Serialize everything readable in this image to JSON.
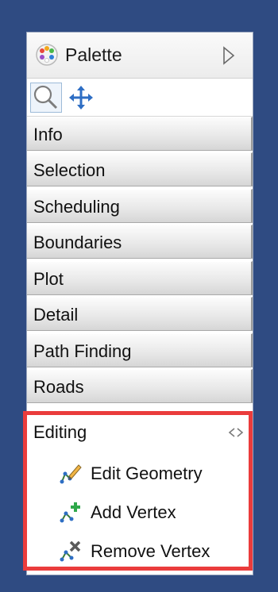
{
  "palette": {
    "title": "Palette",
    "icon": "palette-icon",
    "expand_icon": "triangle-right-icon"
  },
  "toolbar": {
    "tools": [
      {
        "icon": "magnifier-icon",
        "selected": true
      },
      {
        "icon": "move-arrows-icon",
        "selected": false
      }
    ]
  },
  "drawers": [
    {
      "label": "Info"
    },
    {
      "label": "Selection"
    },
    {
      "label": "Scheduling"
    },
    {
      "label": "Boundaries"
    },
    {
      "label": "Plot"
    },
    {
      "label": "Detail"
    },
    {
      "label": "Path Finding"
    },
    {
      "label": "Roads"
    }
  ],
  "editing": {
    "label": "Editing",
    "collapse_icon": "double-arrow-icon",
    "highlight_color": "#ea3c3c",
    "tools": [
      {
        "label": "Edit Geometry",
        "icon": "edit-geometry-icon"
      },
      {
        "label": "Add Vertex",
        "icon": "add-vertex-icon"
      },
      {
        "label": "Remove Vertex",
        "icon": "remove-vertex-icon"
      }
    ]
  },
  "colors": {
    "background": "#2f4b82",
    "panel": "#ffffff",
    "highlight": "#ea3c3c"
  }
}
